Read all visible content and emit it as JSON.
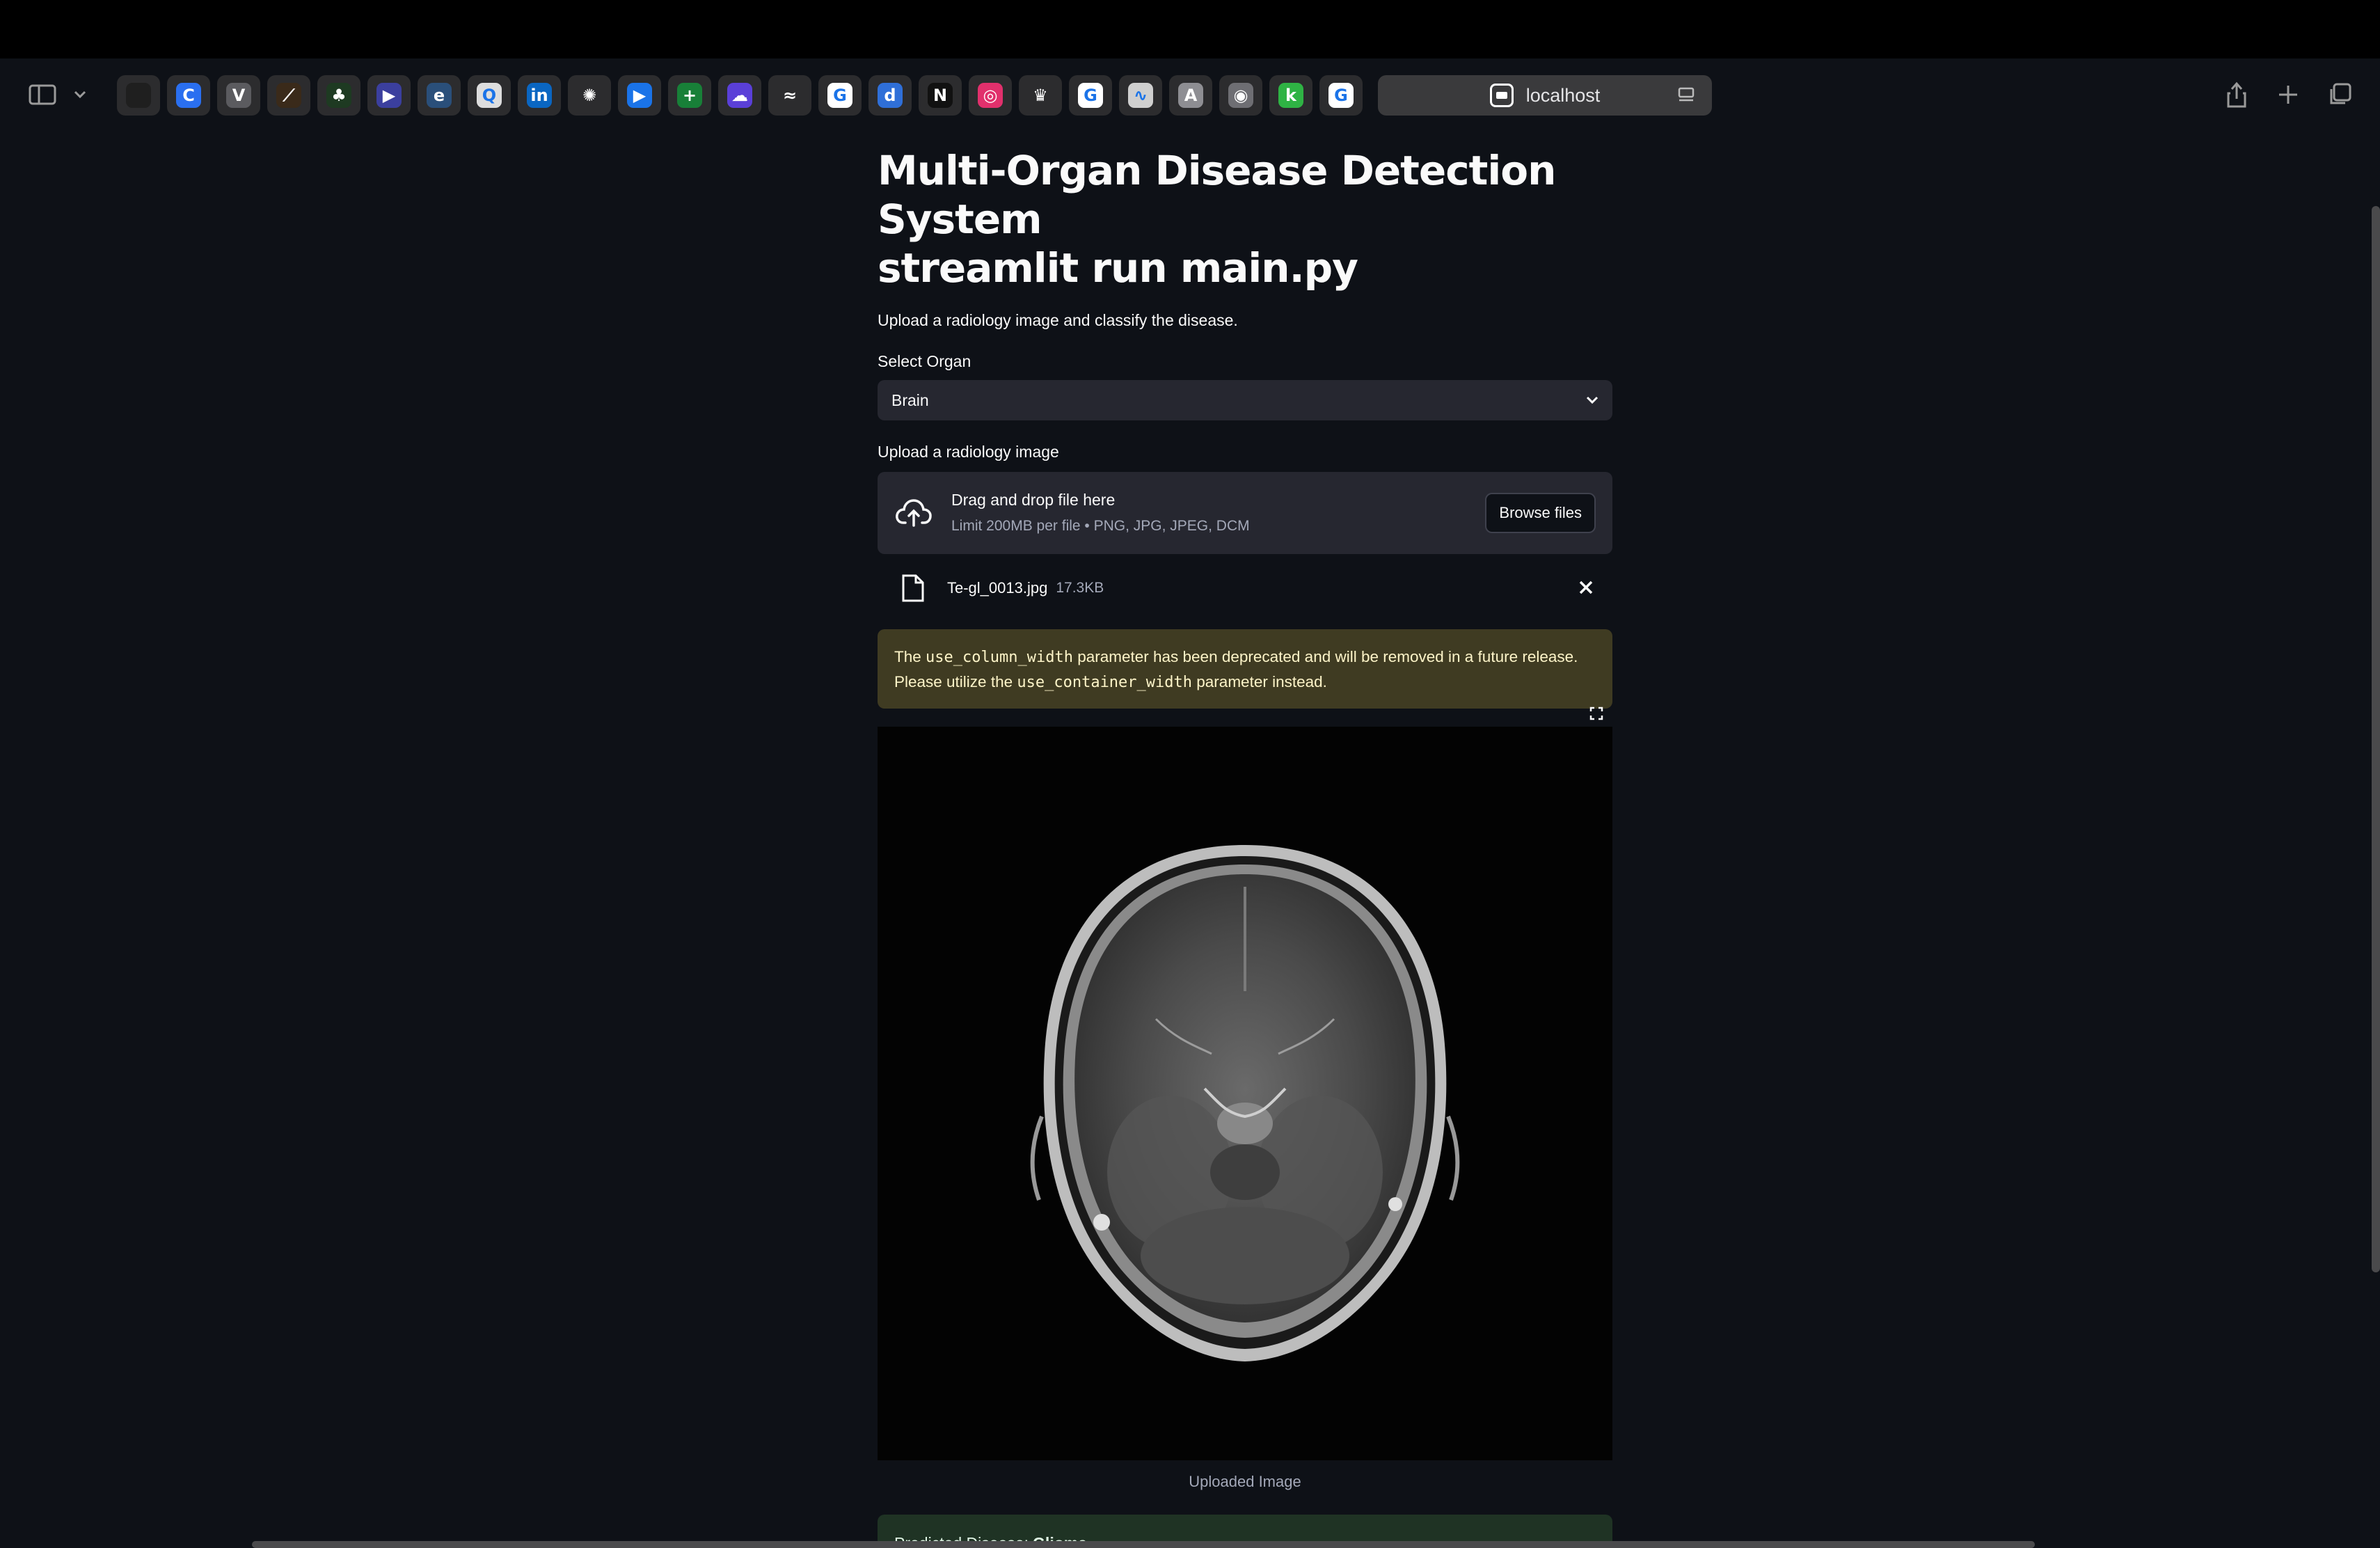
{
  "browser": {
    "address": "localhost",
    "bookmarks": [
      {
        "icon": "github-icon",
        "glyph": "",
        "bg": "#1f1f1f"
      },
      {
        "icon": "edge-copilot-icon",
        "glyph": "C",
        "bg": "#2a6ff0"
      },
      {
        "icon": "v-app-icon",
        "glyph": "V",
        "bg": "#5b5b5f"
      },
      {
        "icon": "slash-app-icon",
        "glyph": "⟋",
        "bg": "#3a2a1a"
      },
      {
        "icon": "leaf-icon",
        "glyph": "♣",
        "bg": "#1e3a22"
      },
      {
        "icon": "play-hex-icon",
        "glyph": "▶",
        "bg": "#3b3f9e"
      },
      {
        "icon": "e-app-icon",
        "glyph": "e",
        "bg": "#2a4f7a"
      },
      {
        "icon": "search-glass-icon",
        "glyph": "Q",
        "bg": "#dddddd"
      },
      {
        "icon": "linkedin-icon",
        "glyph": "in",
        "bg": "#0a66c2"
      },
      {
        "icon": "pinwheel-icon",
        "glyph": "✺",
        "bg": "#2c2c2e"
      },
      {
        "icon": "video-icon",
        "glyph": "▶",
        "bg": "#1a73e8"
      },
      {
        "icon": "sheets-icon",
        "glyph": "+",
        "bg": "#188038"
      },
      {
        "icon": "cloud-app-icon",
        "glyph": "☁",
        "bg": "#5a3fd8"
      },
      {
        "icon": "red-swirl-icon",
        "glyph": "≈",
        "bg": "#2c2c2e"
      },
      {
        "icon": "google-icon",
        "glyph": "G",
        "bg": "#ffffff"
      },
      {
        "icon": "d-app-icon",
        "glyph": "d",
        "bg": "#2f6fd8"
      },
      {
        "icon": "news-app-icon",
        "glyph": "N",
        "bg": "#111111"
      },
      {
        "icon": "instagram-icon",
        "glyph": "◎",
        "bg": "#e1306c"
      },
      {
        "icon": "crown-icon",
        "glyph": "♛",
        "bg": "#2c2c2e"
      },
      {
        "icon": "google-icon",
        "glyph": "G",
        "bg": "#ffffff"
      },
      {
        "icon": "chart-app-icon",
        "glyph": "∿",
        "bg": "#cfcfcf"
      },
      {
        "icon": "a-app-icon",
        "glyph": "A",
        "bg": "#8e8e93"
      },
      {
        "icon": "lock-app-icon",
        "glyph": "◉",
        "bg": "#6e6e73"
      },
      {
        "icon": "k-app-icon",
        "glyph": "k",
        "bg": "#2fb344"
      },
      {
        "icon": "google-icon",
        "glyph": "G",
        "bg": "#ffffff"
      }
    ]
  },
  "page": {
    "title_line1": "Multi-Organ Disease Detection System",
    "title_line2": "streamlit run main.py",
    "subtitle": "Upload a radiology image and classify the disease.",
    "organ_label": "Select Organ",
    "organ_value": "Brain",
    "upload_label": "Upload a radiology image",
    "dropzone_title": "Drag and drop file here",
    "dropzone_hint": "Limit 200MB per file • PNG, JPG, JPEG, DCM",
    "browse_label": "Browse files",
    "file_name": "Te-gl_0013.jpg",
    "file_size": "17.3KB",
    "warning": {
      "p1": "The ",
      "code1": "use_column_width",
      "p2": " parameter has been deprecated and will be removed in a future release. Please utilize the ",
      "code2": "use_container_width",
      "p3": " parameter instead."
    },
    "image_caption": "Uploaded Image",
    "prediction_label": "Predicted Disease:",
    "prediction_value": "Glioma"
  },
  "colors": {
    "background": "#0e1117",
    "widget": "#262730",
    "warning_bg": "#3f3b22",
    "success_bg": "#1f3324"
  }
}
